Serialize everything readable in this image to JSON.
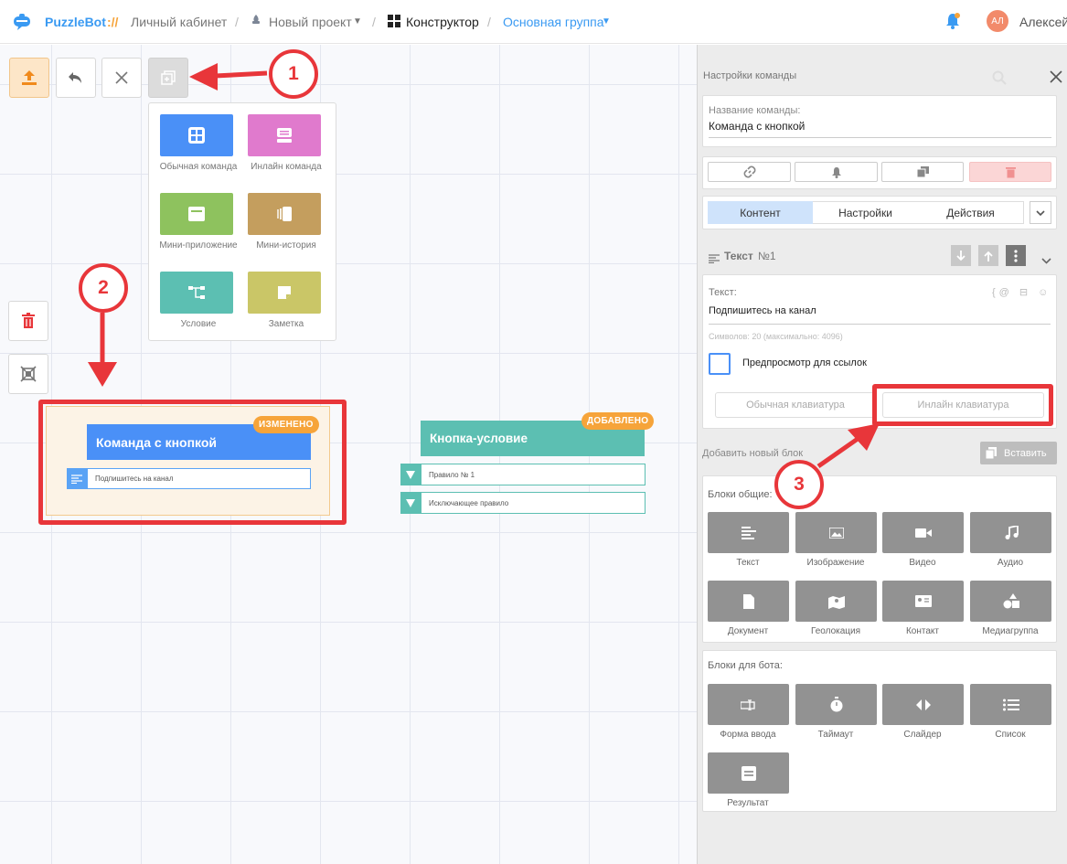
{
  "topbar": {
    "brand": "PuzzleBot",
    "brand_mark": "://",
    "cabinet": "Личный кабинет",
    "project": "Новый проект",
    "constructor": "Конструктор",
    "group": "Основная группа",
    "avatar_initials": "АЛ",
    "user_name": "Алексей"
  },
  "menu": {
    "items": [
      {
        "label": "Обычная команда",
        "color": "#4a90f7",
        "icon": "grid-icon"
      },
      {
        "label": "Инлайн команда",
        "color": "#e07acd",
        "icon": "inline-icon"
      },
      {
        "label": "Мини-приложение",
        "color": "#8ec25e",
        "icon": "window-icon"
      },
      {
        "label": "Мини-история",
        "color": "#c49e5e",
        "icon": "story-icon"
      },
      {
        "label": "Условие",
        "color": "#5cbfb2",
        "icon": "branch-icon"
      },
      {
        "label": "Заметка",
        "color": "#cac667",
        "icon": "note-icon"
      }
    ]
  },
  "nodes": {
    "command": {
      "title": "Команда с кнопкой",
      "badge": "ИЗМЕНЕНО",
      "sub": "Подпишитесь на канал",
      "color": "#4a90f7"
    },
    "condition": {
      "title": "Кнопка-условие",
      "badge": "ДОБАВЛЕНО",
      "rule1": "Правило № 1",
      "rule2": "Исключающее правило",
      "color": "#5cbfb2"
    }
  },
  "panel": {
    "header": "Настройки команды",
    "name_label": "Название команды:",
    "name_value": "Команда с кнопкой",
    "tabs": [
      "Контент",
      "Настройки",
      "Действия"
    ],
    "block_title": "Текст",
    "block_num": "№1",
    "text_label": "Текст:",
    "text_value": "Подпишитесь на канал",
    "char_count": "Символов: 20 (максимально: 4096)",
    "preview_label": "Предпросмотр для ссылок",
    "kb_normal": "Обычная клавиатура",
    "kb_inline": "Инлайн клавиатура",
    "add_block": "Добавить новый блок",
    "paste": "Вставить",
    "common_title": "Блоки общие:",
    "common": [
      "Текст",
      "Изображение",
      "Видео",
      "Аудио",
      "Документ",
      "Геолокация",
      "Контакт",
      "Медиагруппа"
    ],
    "bot_title": "Блоки для бота:",
    "bot": [
      "Форма ввода",
      "Таймаут",
      "Слайдер",
      "Список",
      "Результат"
    ]
  },
  "annotations": [
    "1",
    "2",
    "3"
  ],
  "colors": {
    "accent": "#4a90f7",
    "annotation": "#e8363a",
    "badge": "#f6a43a"
  }
}
